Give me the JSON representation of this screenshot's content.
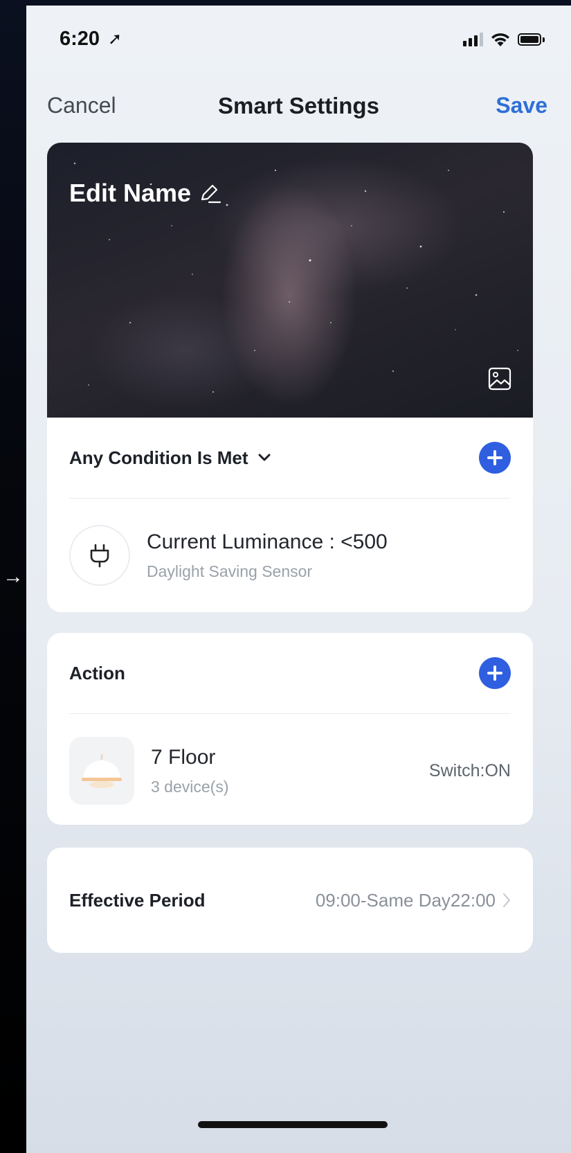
{
  "status": {
    "time": "6:20",
    "location_glyph": "➚"
  },
  "nav": {
    "cancel": "Cancel",
    "title": "Smart Settings",
    "save": "Save"
  },
  "hero": {
    "name": "Edit Name"
  },
  "conditions": {
    "title": "Any Condition Is Met",
    "items": [
      {
        "title": "Current Luminance : <500",
        "subtitle": "Daylight Saving Sensor",
        "icon": "plug-icon"
      }
    ]
  },
  "action": {
    "title": "Action",
    "items": [
      {
        "title": "7 Floor",
        "subtitle": "3 device(s)",
        "value": "Switch:ON",
        "icon": "ceiling-lamp-icon"
      }
    ]
  },
  "period": {
    "label": "Effective Period",
    "value": "09:00-Same Day22:00"
  },
  "colors": {
    "accent": "#2f5fe0",
    "save": "#2f6fd6"
  }
}
